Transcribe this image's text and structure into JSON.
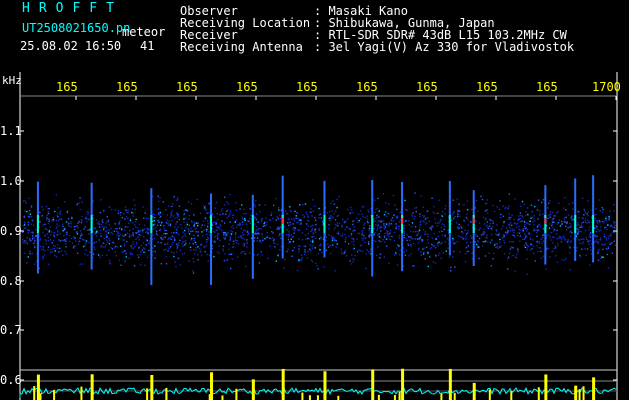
{
  "header": {
    "brand": "HROFFT",
    "filename": "UT2508021650.pn",
    "meteor_label": "meteor",
    "datetime": "25.08.02 16:50",
    "count": "41"
  },
  "info": [
    {
      "label": "Observer",
      "value": ": Masaki Kano"
    },
    {
      "label": "Receiving Location",
      "value": ": Shibukawa, Gunma, Japan"
    },
    {
      "label": "Receiver",
      "value": ": RTL-SDR SDR# 43dB L15 103.2MHz CW"
    },
    {
      "label": "Receiving Antenna",
      "value": ": 3el Yagi(V) Az 330 for Vladivostok"
    }
  ],
  "axis": {
    "unit": "kHz",
    "y_ticks": [
      "1.1",
      "1.0",
      "0.9",
      "0.8",
      "0.7",
      "0.6"
    ],
    "x_ticks": [
      "165",
      "165",
      "165",
      "165",
      "165",
      "165",
      "165",
      "165",
      "165",
      "1700"
    ]
  },
  "colors": {
    "background": "#000000",
    "text": "#ffffff",
    "accent_yellow": "#ffff00",
    "accent_cyan": "#00ffff",
    "noise_blue": "#1020c0"
  },
  "signal": {
    "meteor_columns_khz_fraction": [
      0.03,
      0.12,
      0.22,
      0.32,
      0.39,
      0.44,
      0.51,
      0.59,
      0.64,
      0.72,
      0.76,
      0.88,
      0.93,
      0.96
    ]
  }
}
